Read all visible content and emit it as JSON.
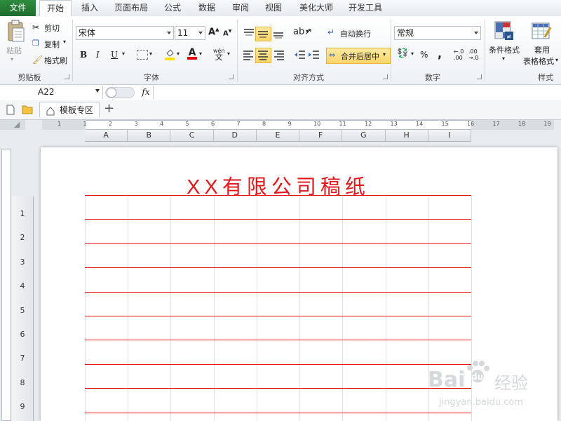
{
  "tabs": {
    "file": "文件",
    "items": [
      "开始",
      "插入",
      "页面布局",
      "公式",
      "数据",
      "审阅",
      "视图",
      "美化大师",
      "开发工具"
    ]
  },
  "clipboard": {
    "paste": "粘贴",
    "cut": "剪切",
    "copy": "复制",
    "format_painter": "格式刷",
    "group_label": "剪贴板"
  },
  "font": {
    "name": "宋体",
    "size": "11",
    "bold": "B",
    "italic": "I",
    "underline": "U",
    "grow": "A",
    "shrink": "A",
    "font_color": "A",
    "wen": "wén",
    "wen_char": "文",
    "group_label": "字体"
  },
  "alignment": {
    "wrap_text": "自动换行",
    "merge_center": "合并后居中",
    "group_label": "对齐方式"
  },
  "number": {
    "format": "常规",
    "percent": "%",
    "comma": ",",
    "inc_decimal": "←.0\n.00",
    "dec_decimal": ".00\n→.0",
    "group_label": "数字"
  },
  "styles": {
    "conditional": "条件格式",
    "table_format_1": "套用",
    "table_format_2": "表格格式",
    "group_label": "样式"
  },
  "formula_bar": {
    "name_box": "A22",
    "fx": "fx",
    "formula": ""
  },
  "doc_tabs": {
    "template": "模板专区",
    "add": "+"
  },
  "ruler_numbers": [
    "1",
    "1",
    "2",
    "3",
    "4",
    "5",
    "6",
    "7",
    "8",
    "9",
    "10",
    "11",
    "12",
    "13",
    "14",
    "15",
    "16",
    "17",
    "18",
    "19"
  ],
  "columns": [
    "A",
    "B",
    "C",
    "D",
    "E",
    "F",
    "G",
    "H",
    "I"
  ],
  "rows": [
    "1",
    "2",
    "3",
    "4",
    "5",
    "6",
    "7",
    "8",
    "9"
  ],
  "sheet": {
    "title": "XX有限公司稿纸",
    "line_color": "#e8121b",
    "title_color": "#e2171c"
  },
  "watermark": {
    "brand": "Bai",
    "brand2": "du",
    "brand_cn": "经验",
    "url": "jingyan.baidu.com"
  }
}
